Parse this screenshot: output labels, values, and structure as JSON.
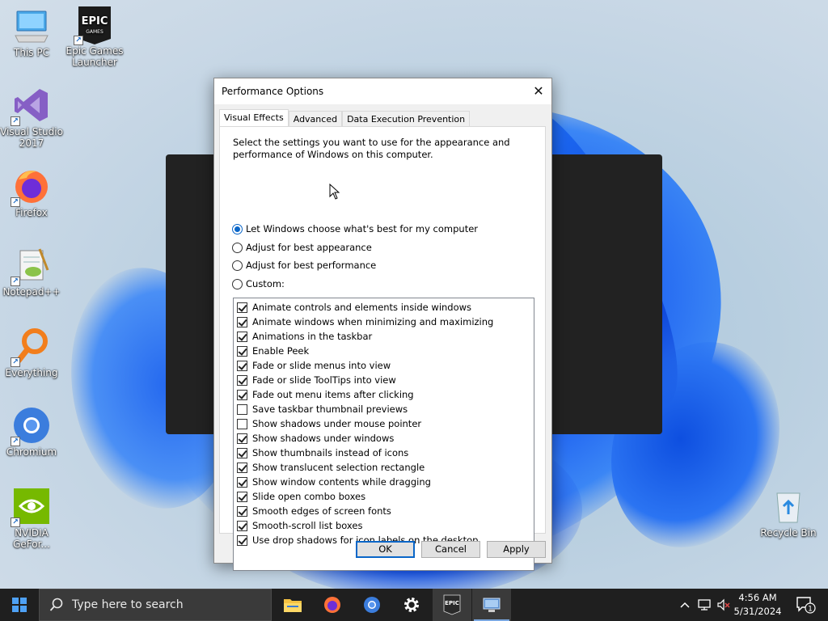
{
  "desktop": {
    "icons": [
      {
        "label": "This PC"
      },
      {
        "label": "Epic Games Launcher",
        "logo_text": "EPIC GAMES"
      },
      {
        "label": "Visual Studio 2017"
      },
      {
        "label": "Firefox"
      },
      {
        "label": "Notepad++"
      },
      {
        "label": "Everything"
      },
      {
        "label": "Chromium"
      },
      {
        "label": "NVIDIA GeFor..."
      },
      {
        "label": "Recycle Bin"
      }
    ]
  },
  "dialog": {
    "title": "Performance Options",
    "tabs": [
      {
        "label": "Visual Effects",
        "active": true
      },
      {
        "label": "Advanced",
        "active": false
      },
      {
        "label": "Data Execution Prevention",
        "active": false
      }
    ],
    "description": "Select the settings you want to use for the appearance and performance of Windows on this computer.",
    "radio_options": [
      {
        "label": "Let Windows choose what's best for my computer",
        "selected": true
      },
      {
        "label": "Adjust for best appearance",
        "selected": false
      },
      {
        "label": "Adjust for best performance",
        "selected": false
      },
      {
        "label": "Custom:",
        "selected": false
      }
    ],
    "effects": [
      {
        "label": "Animate controls and elements inside windows",
        "checked": true
      },
      {
        "label": "Animate windows when minimizing and maximizing",
        "checked": true
      },
      {
        "label": "Animations in the taskbar",
        "checked": true
      },
      {
        "label": "Enable Peek",
        "checked": true
      },
      {
        "label": "Fade or slide menus into view",
        "checked": true
      },
      {
        "label": "Fade or slide ToolTips into view",
        "checked": true
      },
      {
        "label": "Fade out menu items after clicking",
        "checked": true
      },
      {
        "label": "Save taskbar thumbnail previews",
        "checked": false
      },
      {
        "label": "Show shadows under mouse pointer",
        "checked": false
      },
      {
        "label": "Show shadows under windows",
        "checked": true
      },
      {
        "label": "Show thumbnails instead of icons",
        "checked": true
      },
      {
        "label": "Show translucent selection rectangle",
        "checked": true
      },
      {
        "label": "Show window contents while dragging",
        "checked": true
      },
      {
        "label": "Slide open combo boxes",
        "checked": true
      },
      {
        "label": "Smooth edges of screen fonts",
        "checked": true
      },
      {
        "label": "Smooth-scroll list boxes",
        "checked": true
      },
      {
        "label": "Use drop shadows for icon labels on the desktop",
        "checked": true
      }
    ],
    "buttons": {
      "ok": "OK",
      "cancel": "Cancel",
      "apply": "Apply"
    }
  },
  "taskbar": {
    "search_placeholder": "Type here to search",
    "apps": [
      "file-explorer",
      "firefox",
      "chromium",
      "settings",
      "epic-games",
      "system-properties"
    ],
    "epic_logo": "EPIC",
    "clock": {
      "time": "4:56 AM",
      "date": "5/31/2024"
    },
    "notification_count": "1"
  },
  "colors": {
    "accent": "#0a66c8",
    "taskbar": "#1f1f1f",
    "dialog_bg": "#f0f0f0"
  }
}
